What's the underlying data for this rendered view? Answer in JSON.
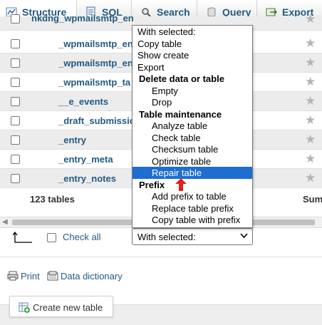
{
  "tabs": [
    {
      "label": "Structure",
      "icon": "structure-icon",
      "active": true
    },
    {
      "label": "SQL",
      "icon": "sql-icon"
    },
    {
      "label": "Search",
      "icon": "search-icon"
    },
    {
      "label": "Query",
      "icon": "query-icon"
    },
    {
      "label": "Export",
      "icon": "export-icon"
    }
  ],
  "tables": [
    {
      "name": "nkdng_wpmailsmtp_en"
    },
    {
      "name": "_wpmailsmtp_en"
    },
    {
      "name": "_wpmailsmtp_en"
    },
    {
      "name": "_wpmailsmtp_ta"
    },
    {
      "name": "__e_events"
    },
    {
      "name": "_draft_submissio"
    },
    {
      "name": "_entry"
    },
    {
      "name": "_entry_meta"
    },
    {
      "name": "_entry_notes"
    }
  ],
  "summary": {
    "count_label": "123 tables",
    "sum_label": "Sum"
  },
  "bulk": {
    "check_all_label": "Check all",
    "select_value": "With selected:"
  },
  "dropdown": {
    "options": [
      {
        "label": "With selected:",
        "kind": "plain"
      },
      {
        "label": "Copy table",
        "kind": "plain"
      },
      {
        "label": "Show create",
        "kind": "plain"
      },
      {
        "label": "Export",
        "kind": "plain"
      },
      {
        "label": "Delete data or table",
        "kind": "group"
      },
      {
        "label": "Empty",
        "kind": "indent"
      },
      {
        "label": "Drop",
        "kind": "indent"
      },
      {
        "label": "Table maintenance",
        "kind": "group"
      },
      {
        "label": "Analyze table",
        "kind": "indent"
      },
      {
        "label": "Check table",
        "kind": "indent"
      },
      {
        "label": "Checksum table",
        "kind": "indent"
      },
      {
        "label": "Optimize table",
        "kind": "indent"
      },
      {
        "label": "Repair table",
        "kind": "indent",
        "selected": true
      },
      {
        "label": "Prefix",
        "kind": "group"
      },
      {
        "label": "Add prefix to table",
        "kind": "indent"
      },
      {
        "label": "Replace table prefix",
        "kind": "indent"
      },
      {
        "label": "Copy table with prefix",
        "kind": "indent"
      }
    ]
  },
  "links": {
    "print": "Print",
    "data_dictionary": "Data dictionary"
  },
  "create_table": {
    "label": "Create new table"
  },
  "colors": {
    "link": "#235a81",
    "selected": "#1e6dd1",
    "star": "#b4b4b4",
    "arrow": "#e0201b"
  }
}
